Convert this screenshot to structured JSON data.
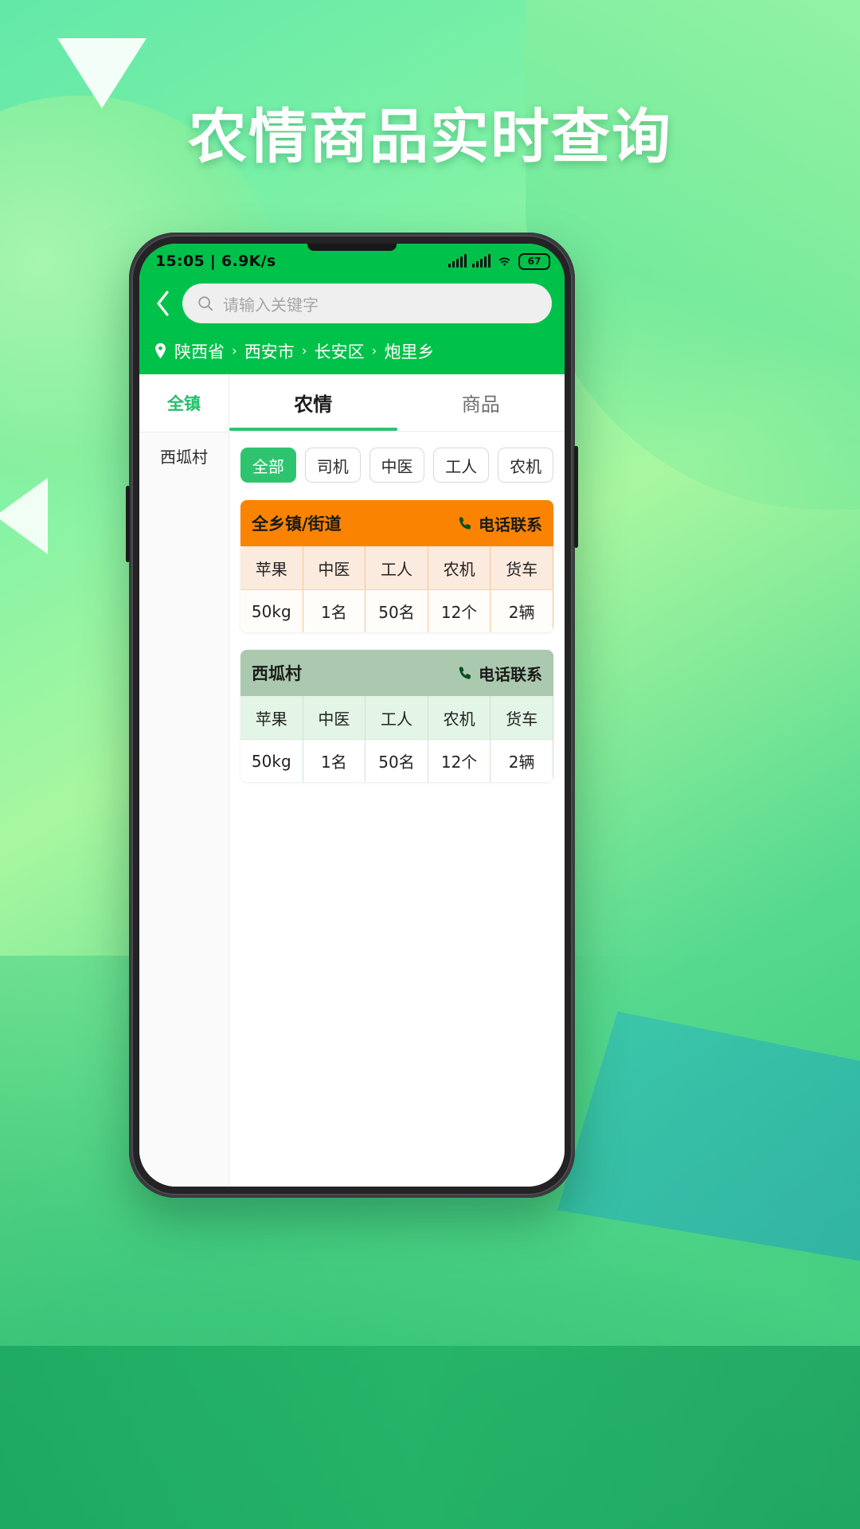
{
  "poster": {
    "title": "农情商品实时查询"
  },
  "status": {
    "time_speed": "15:05 | 6.9K/s",
    "battery": "67",
    "icons": [
      "signal-bars-icon",
      "signal-bars-icon",
      "wifi-icon",
      "battery-icon"
    ]
  },
  "header": {
    "back_icon": "chevron-left-icon",
    "search_placeholder": "请输入关键字",
    "search_value": "",
    "search_icon": "search-icon",
    "location_icon": "map-pin-icon",
    "breadcrumb": [
      "陕西省",
      "西安市",
      "长安区",
      "炮里乡"
    ],
    "breadcrumb_sep": "›"
  },
  "sidebar": {
    "all_label": "全镇",
    "items": [
      {
        "label": "西坬村"
      }
    ]
  },
  "tabs": [
    {
      "label": "农情",
      "active": true
    },
    {
      "label": "商品",
      "active": false
    }
  ],
  "chips": [
    {
      "label": "全部",
      "active": true
    },
    {
      "label": "司机",
      "active": false
    },
    {
      "label": "中医",
      "active": false
    },
    {
      "label": "工人",
      "active": false
    },
    {
      "label": "农机",
      "active": false
    }
  ],
  "cards": [
    {
      "title": "全乡镇/街道",
      "call_label": "电话联系",
      "call_icon": "phone-icon",
      "theme": "orange",
      "columns": [
        "苹果",
        "中医",
        "工人",
        "农机",
        "货车"
      ],
      "values": [
        "50kg",
        "1名",
        "50名",
        "12个",
        "2辆"
      ]
    },
    {
      "title": "西坬村",
      "call_label": "电话联系",
      "call_icon": "phone-icon",
      "theme": "sage",
      "columns": [
        "苹果",
        "中医",
        "工人",
        "农机",
        "货车"
      ],
      "values": [
        "50kg",
        "1名",
        "50名",
        "12个",
        "2辆"
      ]
    }
  ],
  "colors": {
    "brand_green": "#00c24a",
    "accent_green": "#2ec46f",
    "orange": "#fa8401",
    "sage": "#abc9ae"
  }
}
